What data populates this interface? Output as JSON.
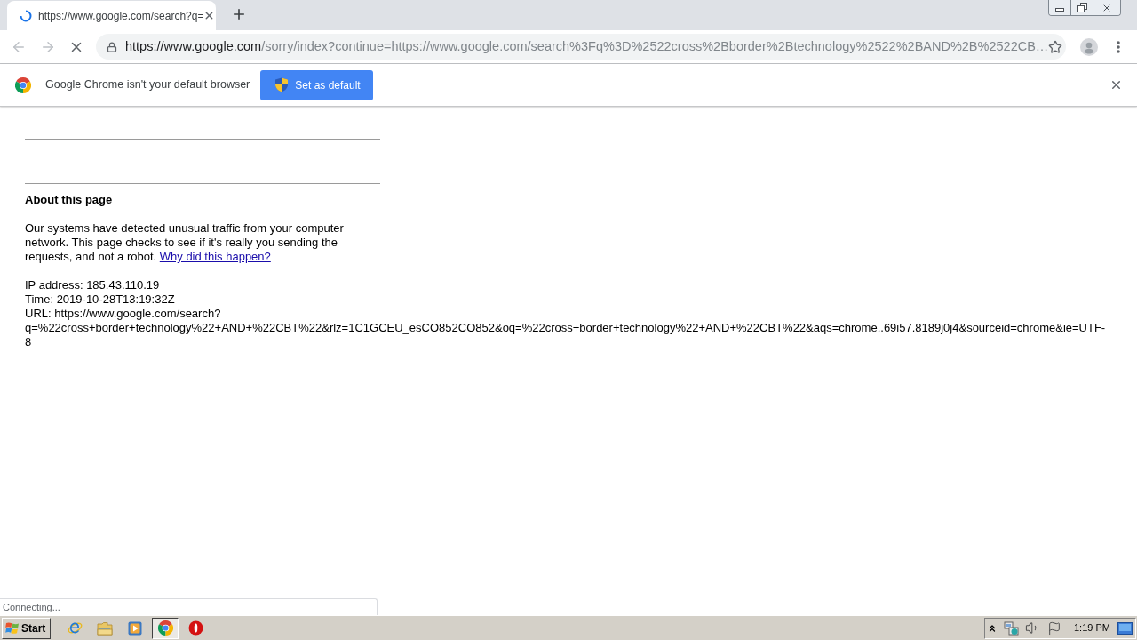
{
  "tabs": [
    {
      "title": "https://www.google.com/search?q=",
      "selected": true,
      "loading": true
    }
  ],
  "toolbar": {
    "back": {
      "disabled": true
    },
    "forward": {
      "disabled": true
    },
    "loading": true
  },
  "address_bar": {
    "host": "https://www.google.com",
    "path": "/sorry/index?continue=https://www.google.com/search%3Fq%3D%2522cross%2Bborder%2Btechnology%2522%2BAND%2B%2522CB…"
  },
  "infobar": {
    "message": "Google Chrome isn't your default browser",
    "button": "Set as default"
  },
  "page": {
    "heading": "About this page",
    "paragraph": "Our systems have detected unusual traffic from your computer network. This page checks to see if it's really you sending the requests, and not a robot.",
    "link": "Why did this happen?",
    "details": [
      "IP address: 185.43.110.19",
      "Time: 2019-10-28T13:19:32Z",
      "URL: https://www.google.com/search?q=%22cross+border+technology%22+AND+%22CBT%22&rlz=1C1GCEU_esCO852CO852&oq=%22cross+border+technology%22+AND+%22CBT%22&aqs=chrome..69i57.8189j0j4&sourceid=chrome&ie=UTF-8"
    ]
  },
  "status_bubble": "Connecting...",
  "taskbar": {
    "start": "Start",
    "apps": [
      {
        "kind": "ie",
        "selected": false
      },
      {
        "kind": "explorer",
        "selected": false
      },
      {
        "kind": "media",
        "selected": false
      },
      {
        "kind": "chrome",
        "selected": true
      },
      {
        "kind": "opera",
        "selected": false
      }
    ],
    "clock": "1:19 PM"
  }
}
